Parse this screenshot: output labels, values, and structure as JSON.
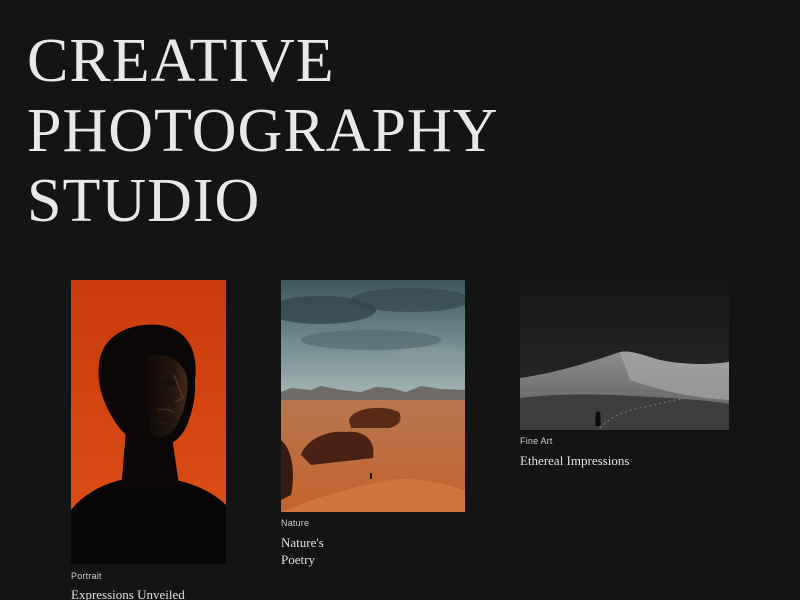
{
  "hero": {
    "title_lines": [
      "CREATIVE",
      "PHOTOGRAPHY",
      "STUDIO"
    ]
  },
  "gallery": {
    "items": [
      {
        "category": "Portrait",
        "title": "Expressions Unveiled",
        "image": "portrait-man-orange-background"
      },
      {
        "category": "Nature",
        "title": "Nature's Poetry",
        "image": "desert-rock-landscape"
      },
      {
        "category": "Fine Art",
        "title": "Ethereal Impressions",
        "image": "monochrome-dune-figure"
      }
    ]
  },
  "colors": {
    "background": "#141414",
    "text": "#e8e8e8",
    "portrait_orange": "#d9410f",
    "desert_sand": "#c46a3f",
    "sky_teal": "#4f6b73"
  }
}
